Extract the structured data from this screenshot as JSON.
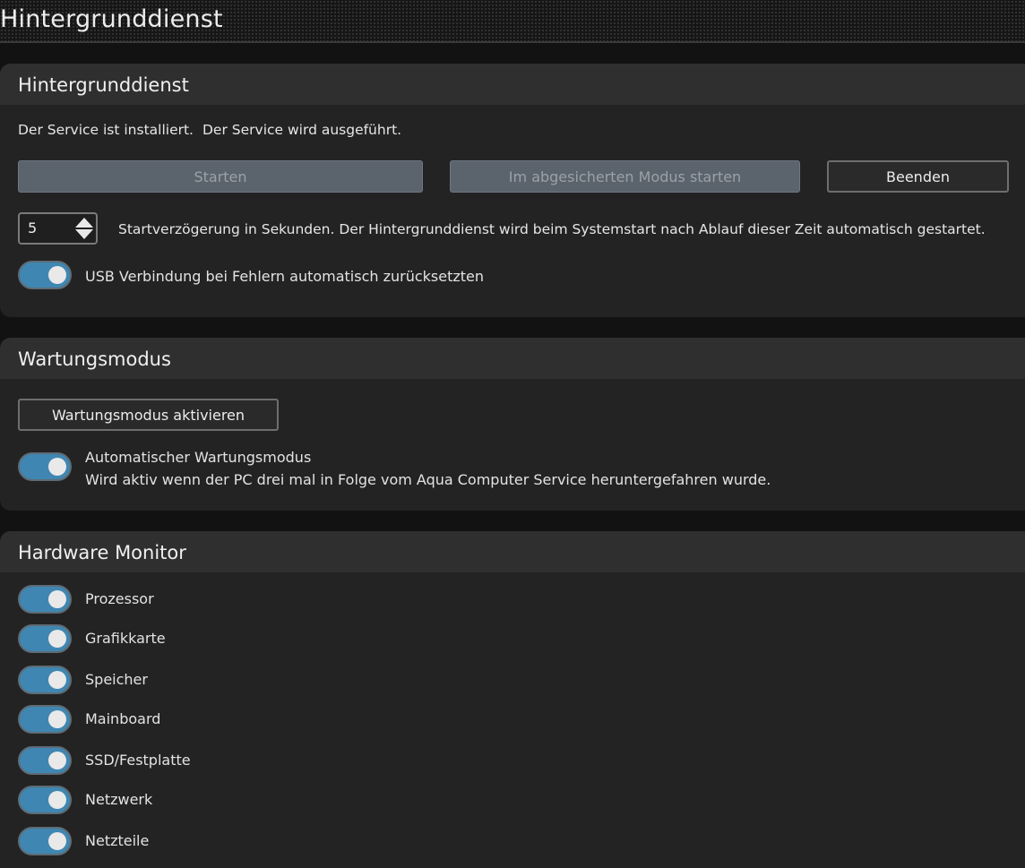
{
  "window": {
    "title": "Hintergrunddienst"
  },
  "service": {
    "section_title": "Hintergrunddienst",
    "status_installed": "Der Service ist installiert.",
    "status_running": "Der Service wird ausgeführt.",
    "start_label": "Starten",
    "safe_mode_label": "Im abgesicherten Modus starten",
    "stop_label": "Beenden",
    "delay_value": "5",
    "delay_description": "Startverzögerung in Sekunden. Der Hintergrunddienst wird beim Systemstart nach Ablauf dieser Zeit automatisch gestartet.",
    "usb_reset_label": "USB Verbindung bei Fehlern automatisch zurücksetzten",
    "usb_reset_on": true
  },
  "maintenance": {
    "section_title": "Wartungsmodus",
    "activate_label": "Wartungsmodus aktivieren",
    "auto_title": "Automatischer Wartungsmodus",
    "auto_description": "Wird aktiv wenn der PC drei mal in Folge vom Aqua Computer Service heruntergefahren wurde.",
    "auto_on": true
  },
  "hardware_monitor": {
    "section_title": "Hardware Monitor",
    "items": [
      {
        "label": "Prozessor",
        "on": true
      },
      {
        "label": "Grafikkarte",
        "on": true
      },
      {
        "label": "Speicher",
        "on": true
      },
      {
        "label": "Mainboard",
        "on": true
      },
      {
        "label": "SSD/Festplatte",
        "on": true
      },
      {
        "label": "Netzwerk",
        "on": true
      },
      {
        "label": "Netzteile",
        "on": true
      }
    ]
  },
  "colors": {
    "toggle_on": "#3f87b2",
    "button_disabled": "#5b636c",
    "card_background": "#232323",
    "card_header": "#2f2f2f"
  }
}
